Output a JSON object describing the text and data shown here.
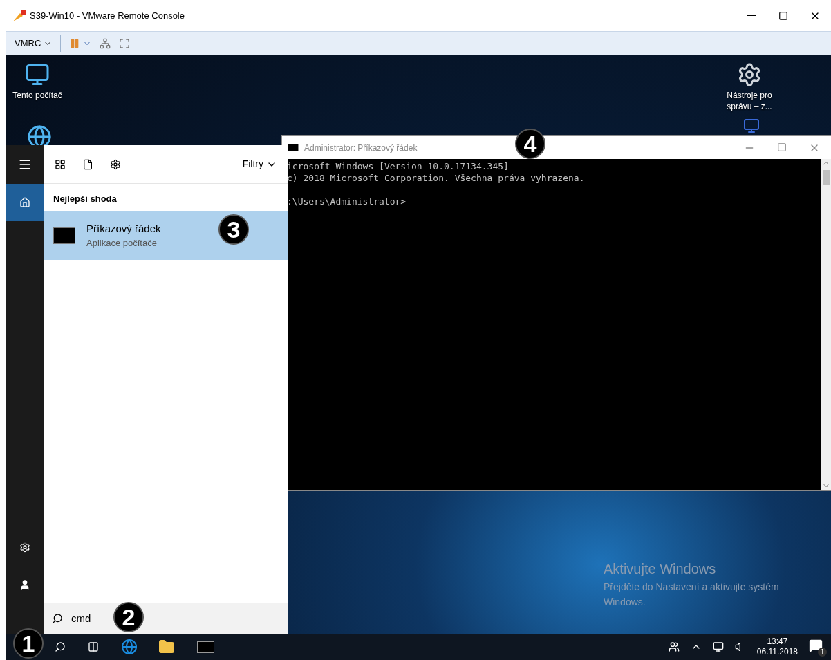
{
  "window": {
    "title": "S39-Win10 - VMware Remote Console"
  },
  "toolbar": {
    "menu": "VMRC"
  },
  "desktop_icons": [
    {
      "label": "Tento počítač",
      "kind": "computer"
    },
    {
      "label": "Nástroje pro správu – z...",
      "kind": "tools"
    }
  ],
  "cmd_window": {
    "title": "Administrator: Příkazový řádek",
    "lines": [
      "icrosoft Windows [Version 10.0.17134.345]",
      "c) 2018 Microsoft Corporation. Všechna práva vyhrazena."
    ],
    "prompt": ":\\Users\\Administrator>"
  },
  "start_menu": {
    "filter": "Filtry",
    "section": "Nejlepší shoda",
    "results": [
      {
        "name": "Příkazový řádek",
        "type": "Aplikace počítače",
        "selected": true
      }
    ],
    "search": {
      "value": "cmd"
    }
  },
  "activation": {
    "title": "Aktivujte Windows",
    "text": "Přejděte do Nastavení a aktivujte systém Windows."
  },
  "taskbar": {
    "time": "13:47",
    "date": "06.11.2018",
    "notifications": "1"
  },
  "callouts": [
    "1",
    "2",
    "3",
    "4"
  ]
}
